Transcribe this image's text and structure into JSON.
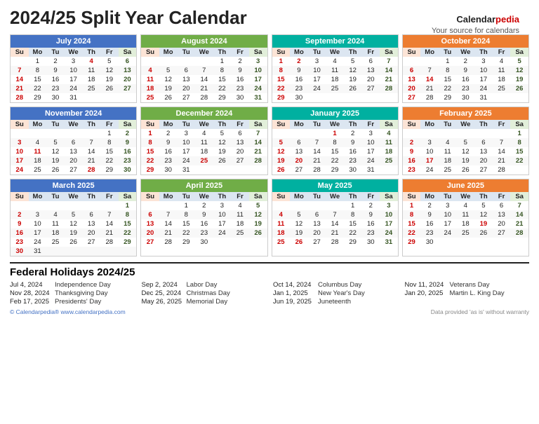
{
  "title": "2024/25 Split Year Calendar",
  "logo": {
    "brand": "Calendar",
    "brand2": "pedia",
    "tagline": "Your source for calendars"
  },
  "footer_left": "© Calendarpedia®  www.calendarpedia.com",
  "footer_right": "Data provided 'as is' without warranty",
  "holidays_title": "Federal Holidays 2024/25",
  "holidays": [
    {
      "date": "Jul 4, 2024",
      "name": "Independence Day"
    },
    {
      "date": "Sep 2, 2024",
      "name": "Labor Day"
    },
    {
      "date": "Oct 14, 2024",
      "name": "Columbus Day"
    },
    {
      "date": "Nov 11, 2024",
      "name": "Veterans Day"
    },
    {
      "date": "Nov 28, 2024",
      "name": "Thanksgiving Day"
    },
    {
      "date": "Dec 25, 2024",
      "name": "Christmas Day"
    },
    {
      "date": "Jan 1, 2025",
      "name": "New Year's Day"
    },
    {
      "date": "Jan 20, 2025",
      "name": "Martin L. King Day"
    },
    {
      "date": "Feb 17, 2025",
      "name": "Presidents' Day"
    },
    {
      "date": "May 26, 2025",
      "name": "Memorial Day"
    },
    {
      "date": "Jun 19, 2025",
      "name": "Juneteenth"
    }
  ],
  "calendars": [
    {
      "title": "July 2024",
      "color": "blue",
      "days": [
        "Su",
        "Mo",
        "Tu",
        "We",
        "Th",
        "Fr",
        "Sa"
      ],
      "rows": [
        [
          "",
          "1",
          "2",
          "3",
          "4*",
          "5",
          "6"
        ],
        [
          "7",
          "8",
          "9",
          "10",
          "11",
          "12",
          "13"
        ],
        [
          "14",
          "15",
          "16",
          "17",
          "18",
          "19",
          "20"
        ],
        [
          "21",
          "22",
          "23",
          "24",
          "25",
          "26",
          "27"
        ],
        [
          "28",
          "29",
          "30",
          "31",
          "",
          "",
          ""
        ]
      ],
      "holidays": [
        "4"
      ]
    },
    {
      "title": "August 2024",
      "color": "green",
      "days": [
        "Su",
        "Mo",
        "Tu",
        "We",
        "Th",
        "Fr",
        "Sa"
      ],
      "rows": [
        [
          "",
          "",
          "",
          "",
          "1",
          "2",
          "3"
        ],
        [
          "4",
          "5",
          "6",
          "7",
          "8",
          "9",
          "10"
        ],
        [
          "11",
          "12",
          "13",
          "14",
          "15",
          "16",
          "17"
        ],
        [
          "18",
          "19",
          "20",
          "21",
          "22",
          "23",
          "24"
        ],
        [
          "25",
          "26",
          "27",
          "28",
          "29",
          "30",
          "31"
        ]
      ],
      "holidays": []
    },
    {
      "title": "September 2024",
      "color": "teal",
      "days": [
        "Su",
        "Mo",
        "Tu",
        "We",
        "Th",
        "Fr",
        "Sa"
      ],
      "rows": [
        [
          "1",
          "2*",
          "3",
          "4",
          "5",
          "6",
          "7"
        ],
        [
          "8",
          "9",
          "10",
          "11",
          "12",
          "13",
          "14"
        ],
        [
          "15",
          "16",
          "17",
          "18",
          "19",
          "20",
          "21"
        ],
        [
          "22",
          "23",
          "24",
          "25",
          "26",
          "27",
          "28"
        ],
        [
          "29",
          "30",
          "",
          "",
          "",
          "",
          ""
        ]
      ],
      "holidays": [
        "2"
      ]
    },
    {
      "title": "October 2024",
      "color": "orange",
      "days": [
        "Su",
        "Mo",
        "Tu",
        "We",
        "Th",
        "Fr",
        "Sa"
      ],
      "rows": [
        [
          "",
          "",
          "1",
          "2",
          "3",
          "4",
          "5"
        ],
        [
          "6",
          "7",
          "8",
          "9",
          "10",
          "11",
          "12"
        ],
        [
          "13",
          "14*",
          "15",
          "16",
          "17",
          "18",
          "19"
        ],
        [
          "20",
          "21",
          "22",
          "23",
          "24",
          "25",
          "26"
        ],
        [
          "27",
          "28",
          "29",
          "30",
          "31",
          "",
          ""
        ]
      ],
      "holidays": [
        "14"
      ]
    },
    {
      "title": "November 2024",
      "color": "blue",
      "days": [
        "Su",
        "Mo",
        "Tu",
        "We",
        "Th",
        "Fr",
        "Sa"
      ],
      "rows": [
        [
          "",
          "",
          "",
          "",
          "",
          "1",
          "2"
        ],
        [
          "3",
          "4",
          "5",
          "6",
          "7",
          "8",
          "9"
        ],
        [
          "10",
          "11*",
          "12",
          "13",
          "14",
          "15",
          "16"
        ],
        [
          "17",
          "18",
          "19",
          "20",
          "21",
          "22",
          "23"
        ],
        [
          "24",
          "25",
          "26",
          "27",
          "28*",
          "29",
          "30"
        ]
      ],
      "holidays": [
        "11",
        "28"
      ]
    },
    {
      "title": "December 2024",
      "color": "green",
      "days": [
        "Su",
        "Mo",
        "Tu",
        "We",
        "Th",
        "Fr",
        "Sa"
      ],
      "rows": [
        [
          "1",
          "2",
          "3",
          "4",
          "5",
          "6",
          "7"
        ],
        [
          "8",
          "9",
          "10",
          "11",
          "12",
          "13",
          "14"
        ],
        [
          "15",
          "16",
          "17",
          "18",
          "19",
          "20",
          "21"
        ],
        [
          "22",
          "23",
          "24",
          "25*",
          "26",
          "27",
          "28"
        ],
        [
          "29",
          "30",
          "31",
          "",
          "",
          "",
          ""
        ]
      ],
      "holidays": [
        "25"
      ]
    },
    {
      "title": "January 2025",
      "color": "teal",
      "days": [
        "Su",
        "Mo",
        "Tu",
        "We",
        "Th",
        "Fr",
        "Sa"
      ],
      "rows": [
        [
          "",
          "",
          "",
          "1*",
          "2",
          "3",
          "4"
        ],
        [
          "5",
          "6",
          "7",
          "8",
          "9",
          "10",
          "11"
        ],
        [
          "12",
          "13",
          "14",
          "15",
          "16",
          "17",
          "18"
        ],
        [
          "19",
          "20*",
          "21",
          "22",
          "23",
          "24",
          "25"
        ],
        [
          "26",
          "27",
          "28",
          "29",
          "30",
          "31",
          ""
        ]
      ],
      "holidays": [
        "1",
        "20"
      ]
    },
    {
      "title": "February 2025",
      "color": "orange",
      "days": [
        "Su",
        "Mo",
        "Tu",
        "We",
        "Th",
        "Fr",
        "Sa"
      ],
      "rows": [
        [
          "",
          "",
          "",
          "",
          "",
          "",
          "1"
        ],
        [
          "2",
          "3",
          "4",
          "5",
          "6",
          "7",
          "8"
        ],
        [
          "9",
          "10",
          "11",
          "12",
          "13",
          "14",
          "15"
        ],
        [
          "16",
          "17*",
          "18",
          "19",
          "20",
          "21",
          "22"
        ],
        [
          "23",
          "24",
          "25",
          "26",
          "27",
          "28",
          ""
        ]
      ],
      "holidays": [
        "17"
      ]
    },
    {
      "title": "March 2025",
      "color": "blue",
      "days": [
        "Su",
        "Mo",
        "Tu",
        "We",
        "Th",
        "Fr",
        "Sa"
      ],
      "rows": [
        [
          "",
          "",
          "",
          "",
          "",
          "",
          "1"
        ],
        [
          "2",
          "3",
          "4",
          "5",
          "6",
          "7",
          "8"
        ],
        [
          "9",
          "10",
          "11",
          "12",
          "13",
          "14",
          "15"
        ],
        [
          "16",
          "17",
          "18",
          "19",
          "20",
          "21",
          "22"
        ],
        [
          "23",
          "24",
          "25",
          "26",
          "27",
          "28",
          "29"
        ],
        [
          "30",
          "31",
          "",
          "",
          "",
          "",
          ""
        ]
      ],
      "holidays": []
    },
    {
      "title": "April 2025",
      "color": "green",
      "days": [
        "Su",
        "Mo",
        "Tu",
        "We",
        "Th",
        "Fr",
        "Sa"
      ],
      "rows": [
        [
          "",
          "",
          "1",
          "2",
          "3",
          "4",
          "5"
        ],
        [
          "6",
          "7",
          "8",
          "9",
          "10",
          "11",
          "12"
        ],
        [
          "13",
          "14",
          "15",
          "16",
          "17",
          "18",
          "19"
        ],
        [
          "20",
          "21",
          "22",
          "23",
          "24",
          "25",
          "26"
        ],
        [
          "27",
          "28",
          "29",
          "30",
          "",
          "",
          ""
        ]
      ],
      "holidays": []
    },
    {
      "title": "May 2025",
      "color": "teal",
      "days": [
        "Su",
        "Mo",
        "Tu",
        "We",
        "Th",
        "Fr",
        "Sa"
      ],
      "rows": [
        [
          "",
          "",
          "",
          "",
          "1",
          "2",
          "3"
        ],
        [
          "4",
          "5",
          "6",
          "7",
          "8",
          "9",
          "10"
        ],
        [
          "11",
          "12",
          "13",
          "14",
          "15",
          "16",
          "17"
        ],
        [
          "18",
          "19",
          "20",
          "21",
          "22",
          "23",
          "24"
        ],
        [
          "25",
          "26*",
          "27",
          "28",
          "29",
          "30",
          "31"
        ]
      ],
      "holidays": [
        "26"
      ]
    },
    {
      "title": "June 2025",
      "color": "orange",
      "days": [
        "Su",
        "Mo",
        "Tu",
        "We",
        "Th",
        "Fr",
        "Sa"
      ],
      "rows": [
        [
          "1",
          "2",
          "3",
          "4",
          "5",
          "6",
          "7"
        ],
        [
          "8",
          "9",
          "10",
          "11",
          "12",
          "13",
          "14"
        ],
        [
          "15",
          "16",
          "17",
          "18",
          "19*",
          "20",
          "21"
        ],
        [
          "22",
          "23",
          "24",
          "25",
          "26",
          "27",
          "28"
        ],
        [
          "29",
          "30",
          "",
          "",
          "",
          "",
          ""
        ]
      ],
      "holidays": [
        "19"
      ]
    }
  ]
}
